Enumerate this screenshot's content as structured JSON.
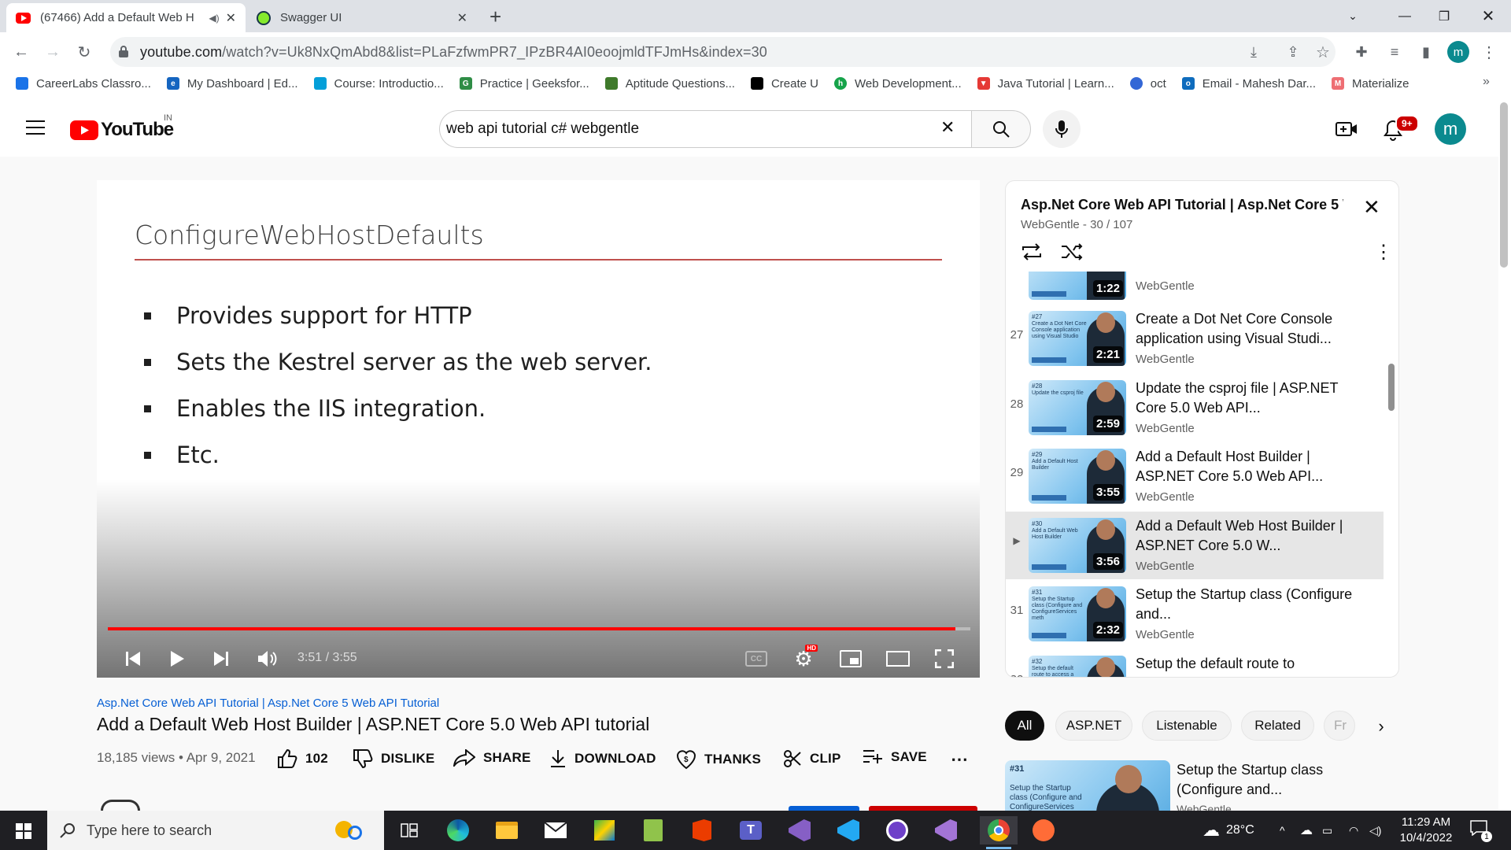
{
  "browser": {
    "tabs": [
      {
        "title": "(67466) Add a Default Web H",
        "active": true
      },
      {
        "title": "Swagger UI",
        "active": false
      }
    ],
    "url_host": "youtube.com",
    "url_path": "/watch?v=Uk8NxQmAbd8&list=PLaFzfwmPR7_IPzBR4AI0eoojmldTFJmHs&index=30",
    "profile_initial": "m",
    "bookmarks": [
      {
        "label": "CareerLabs Classro...",
        "color": "#1a73e8"
      },
      {
        "label": "My Dashboard | Ed...",
        "color": "#1565c0"
      },
      {
        "label": "Course: Introductio...",
        "color": "#049fd9"
      },
      {
        "label": "Practice | Geeksfor...",
        "color": "#2f8d46"
      },
      {
        "label": "Aptitude Questions...",
        "color": "#3f7a2b"
      },
      {
        "label": "Create U",
        "color": "#000000"
      },
      {
        "label": "Web Development...",
        "color": "#16a34a"
      },
      {
        "label": "Java Tutorial | Learn...",
        "color": "#e53935"
      },
      {
        "label": "oct",
        "color": "#3367d6"
      },
      {
        "label": "Email - Mahesh Dar...",
        "color": "#0f6cbd"
      },
      {
        "label": "Materialize",
        "color": "#ee6e73"
      }
    ]
  },
  "youtube": {
    "logo_text": "YouTube",
    "region": "IN",
    "search_value": "web api tutorial c# webgentle",
    "notif_badge": "9+",
    "avatar_initial": "m"
  },
  "slide": {
    "title": "ConfigureWebHostDefaults",
    "bullets": [
      "Provides support for HTTP",
      "Sets the Kestrel server as the web server.",
      "Enables the IIS integration.",
      "Etc."
    ]
  },
  "player": {
    "time": "3:51 / 3:55",
    "progress": 0.983,
    "hd_badge": "HD",
    "cc_label": "CC"
  },
  "video": {
    "playlist_link": "Asp.Net Core Web API Tutorial | Asp.Net Core 5 Web API Tutorial",
    "title": "Add a Default Web Host Builder | ASP.NET Core 5.0 Web API tutorial",
    "meta": "18,185 views • Apr 9, 2021",
    "likes": "102",
    "actions": {
      "dislike": "DISLIKE",
      "share": "SHARE",
      "download": "DOWNLOAD",
      "thanks": "THANKS",
      "clip": "CLIP",
      "save": "SAVE"
    }
  },
  "playlist": {
    "title": "Asp.Net Core Web API Tutorial | Asp.Net Core 5 We...",
    "subtitle": "WebGentle - 30 / 107",
    "partial_item": {
      "duration": "1:22",
      "channel": "WebGentle"
    },
    "items": [
      {
        "num": "27",
        "title": "Create a Dot Net Core Console application using Visual Studi...",
        "channel": "WebGentle",
        "duration": "2:21",
        "thumb_no": "#27",
        "thumb_text": "Create a Dot Net Core Console application using Visual Studio"
      },
      {
        "num": "28",
        "title": "Update the csproj file | ASP.NET Core 5.0 Web API...",
        "channel": "WebGentle",
        "duration": "2:59",
        "thumb_no": "#28",
        "thumb_text": "Update the csproj file"
      },
      {
        "num": "29",
        "title": "Add a Default Host Builder | ASP.NET Core 5.0 Web API...",
        "channel": "WebGentle",
        "duration": "3:55",
        "thumb_no": "#29",
        "thumb_text": "Add a Default Host Builder"
      },
      {
        "num": "▶",
        "title": "Add a Default Web Host Builder | ASP.NET Core 5.0 W...",
        "channel": "WebGentle",
        "duration": "3:56",
        "thumb_no": "#30",
        "thumb_text": "Add a Default Web Host Builder",
        "current": true
      },
      {
        "num": "31",
        "title": "Setup the Startup class (Configure and...",
        "channel": "WebGentle",
        "duration": "2:32",
        "thumb_no": "#31",
        "thumb_text": "Setup the Startup class (Configure and ConfigureServices meth"
      },
      {
        "num": "32",
        "title": "Setup the default route to",
        "channel": "",
        "duration": "",
        "thumb_no": "#32",
        "thumb_text": "Setup the default route to access a resource"
      }
    ]
  },
  "chips": [
    "All",
    "ASP.NET",
    "Listenable",
    "Related",
    "Fr"
  ],
  "related": {
    "title": "Setup the Startup class (Configure and...",
    "channel": "WebGentle",
    "thumb_no": "#31",
    "thumb_text": "Setup the Startup class (Configure and ConfigureServices metho"
  },
  "taskbar": {
    "search_placeholder": "Type here to search",
    "temperature": "28°C",
    "time": "11:29 AM",
    "date": "10/4/2022",
    "notif_count": "1"
  }
}
